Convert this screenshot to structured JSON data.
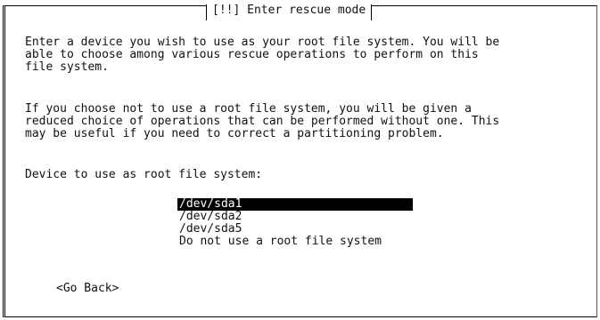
{
  "dialog": {
    "title": "[!!] Enter rescue mode",
    "paragraph1": "Enter a device you wish to use as your root file system. You will be\nable to choose among various rescue operations to perform on this\nfile system.",
    "paragraph2": "If you choose not to use a root file system, you will be given a\nreduced choice of operations that can be performed without one. This\nmay be useful if you need to correct a partitioning problem.",
    "prompt": "Device to use as root file system:",
    "options": [
      "/dev/sda1",
      "/dev/sda2",
      "/dev/sda5",
      "Do not use a root file system"
    ],
    "selected_option": "/dev/sda1",
    "go_back_label": "<Go Back>"
  },
  "colors": {
    "background": "#ffffff",
    "text": "#111111",
    "selection_background": "#000000",
    "selection_text": "#ffffff"
  }
}
